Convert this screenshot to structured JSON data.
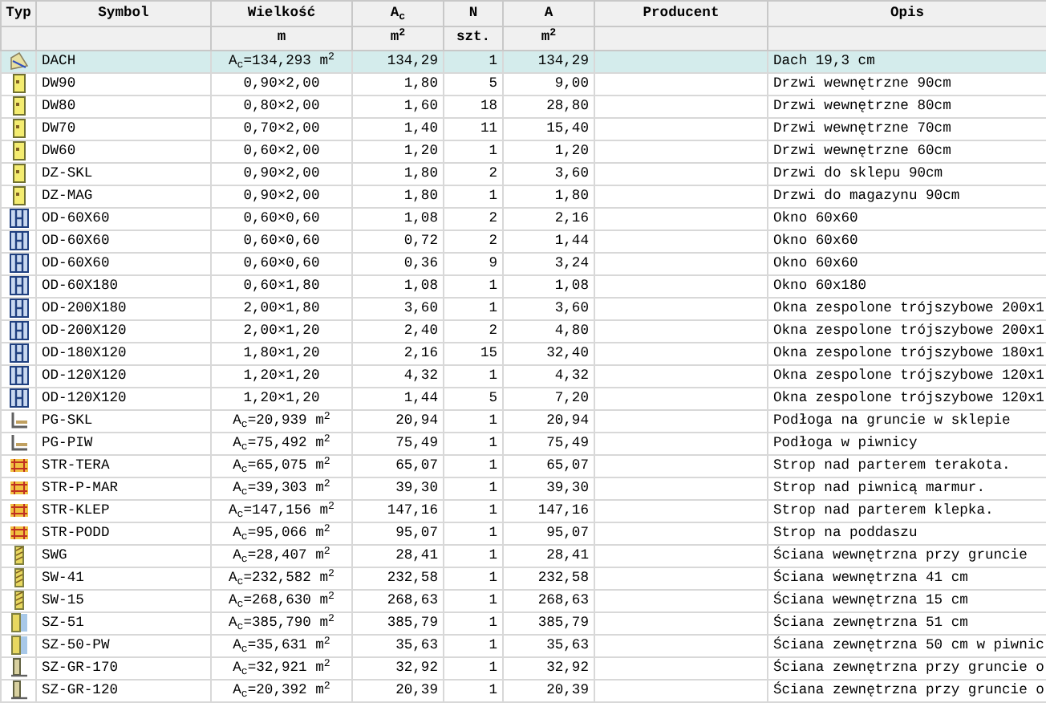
{
  "table": {
    "columns": [
      {
        "label": "Typ"
      },
      {
        "label": "Symbol"
      },
      {
        "label": "Wielkość",
        "unit": "m"
      },
      {
        "label": "A$_{c}$",
        "unit": "m$^{2}$"
      },
      {
        "label": "N",
        "unit": "szt."
      },
      {
        "label": "A",
        "unit": "m$^{2}$"
      },
      {
        "label": "Producent"
      },
      {
        "label": "Opis"
      }
    ],
    "rows": [
      {
        "kind": "roof",
        "selected": true,
        "symbol": "DACH",
        "size": "A$_{c}$=134,293 m$^{2}$",
        "ac": "134,29",
        "n": "1",
        "a": "134,29",
        "description": "Dach 19,3 cm"
      },
      {
        "kind": "door",
        "selected": false,
        "symbol": "DW90",
        "size": "0,90×2,00",
        "ac": "1,80",
        "n": "5",
        "a": "9,00",
        "description": "Drzwi wewnętrzne 90cm"
      },
      {
        "kind": "door",
        "selected": false,
        "symbol": "DW80",
        "size": "0,80×2,00",
        "ac": "1,60",
        "n": "18",
        "a": "28,80",
        "description": "Drzwi wewnętrzne 80cm"
      },
      {
        "kind": "door",
        "selected": false,
        "symbol": "DW70",
        "size": "0,70×2,00",
        "ac": "1,40",
        "n": "11",
        "a": "15,40",
        "description": "Drzwi wewnętrzne 70cm"
      },
      {
        "kind": "door",
        "selected": false,
        "symbol": "DW60",
        "size": "0,60×2,00",
        "ac": "1,20",
        "n": "1",
        "a": "1,20",
        "description": "Drzwi wewnętrzne 60cm"
      },
      {
        "kind": "door",
        "selected": false,
        "symbol": "DZ-SKL",
        "size": "0,90×2,00",
        "ac": "1,80",
        "n": "2",
        "a": "3,60",
        "description": "Drzwi do sklepu 90cm"
      },
      {
        "kind": "door",
        "selected": false,
        "symbol": "DZ-MAG",
        "size": "0,90×2,00",
        "ac": "1,80",
        "n": "1",
        "a": "1,80",
        "description": "Drzwi do magazynu 90cm"
      },
      {
        "kind": "window",
        "selected": false,
        "symbol": "OD-60X60",
        "size": "0,60×0,60",
        "ac": "1,08",
        "n": "2",
        "a": "2,16",
        "description": "Okno 60x60"
      },
      {
        "kind": "window",
        "selected": false,
        "symbol": "OD-60X60",
        "size": "0,60×0,60",
        "ac": "0,72",
        "n": "2",
        "a": "1,44",
        "description": "Okno 60x60"
      },
      {
        "kind": "window",
        "selected": false,
        "symbol": "OD-60X60",
        "size": "0,60×0,60",
        "ac": "0,36",
        "n": "9",
        "a": "3,24",
        "description": "Okno 60x60"
      },
      {
        "kind": "window",
        "selected": false,
        "symbol": "OD-60X180",
        "size": "0,60×1,80",
        "ac": "1,08",
        "n": "1",
        "a": "1,08",
        "description": "Okno 60x180"
      },
      {
        "kind": "window",
        "selected": false,
        "symbol": "OD-200X180",
        "size": "2,00×1,80",
        "ac": "3,60",
        "n": "1",
        "a": "3,60",
        "description": "Okna zespolone trójszybowe 200x1"
      },
      {
        "kind": "window",
        "selected": false,
        "symbol": "OD-200X120",
        "size": "2,00×1,20",
        "ac": "2,40",
        "n": "2",
        "a": "4,80",
        "description": "Okna zespolone trójszybowe 200x1"
      },
      {
        "kind": "window",
        "selected": false,
        "symbol": "OD-180X120",
        "size": "1,80×1,20",
        "ac": "2,16",
        "n": "15",
        "a": "32,40",
        "description": "Okna zespolone trójszybowe 180x1"
      },
      {
        "kind": "window",
        "selected": false,
        "symbol": "OD-120X120",
        "size": "1,20×1,20",
        "ac": "4,32",
        "n": "1",
        "a": "4,32",
        "description": "Okna zespolone trójszybowe 120x1"
      },
      {
        "kind": "window",
        "selected": false,
        "symbol": "OD-120X120",
        "size": "1,20×1,20",
        "ac": "1,44",
        "n": "5",
        "a": "7,20",
        "description": "Okna zespolone trójszybowe 120x1"
      },
      {
        "kind": "floor",
        "selected": false,
        "symbol": "PG-SKL",
        "size": "A$_{c}$=20,939 m$^{2}$",
        "ac": "20,94",
        "n": "1",
        "a": "20,94",
        "description": "Podłoga na gruncie w sklepie"
      },
      {
        "kind": "floor",
        "selected": false,
        "symbol": "PG-PIW",
        "size": "A$_{c}$=75,492 m$^{2}$",
        "ac": "75,49",
        "n": "1",
        "a": "75,49",
        "description": "Podłoga w piwnicy"
      },
      {
        "kind": "ceiling",
        "selected": false,
        "symbol": "STR-TERA",
        "size": "A$_{c}$=65,075 m$^{2}$",
        "ac": "65,07",
        "n": "1",
        "a": "65,07",
        "description": "Strop nad parterem terakota."
      },
      {
        "kind": "ceiling",
        "selected": false,
        "symbol": "STR-P-MAR",
        "size": "A$_{c}$=39,303 m$^{2}$",
        "ac": "39,30",
        "n": "1",
        "a": "39,30",
        "description": "Strop nad piwnicą marmur."
      },
      {
        "kind": "ceiling",
        "selected": false,
        "symbol": "STR-KLEP",
        "size": "A$_{c}$=147,156 m$^{2}$",
        "ac": "147,16",
        "n": "1",
        "a": "147,16",
        "description": "Strop nad parterem klepka."
      },
      {
        "kind": "ceiling",
        "selected": false,
        "symbol": "STR-PODD",
        "size": "A$_{c}$=95,066 m$^{2}$",
        "ac": "95,07",
        "n": "1",
        "a": "95,07",
        "description": "Strop na poddaszu"
      },
      {
        "kind": "wall",
        "selected": false,
        "symbol": "SWG",
        "size": "A$_{c}$=28,407 m$^{2}$",
        "ac": "28,41",
        "n": "1",
        "a": "28,41",
        "description": "Ściana wewnętrzna przy gruncie"
      },
      {
        "kind": "wall",
        "selected": false,
        "symbol": "SW-41",
        "size": "A$_{c}$=232,582 m$^{2}$",
        "ac": "232,58",
        "n": "1",
        "a": "232,58",
        "description": "Ściana wewnętrzna 41 cm"
      },
      {
        "kind": "wall",
        "selected": false,
        "symbol": "SW-15",
        "size": "A$_{c}$=268,630 m$^{2}$",
        "ac": "268,63",
        "n": "1",
        "a": "268,63",
        "description": "Ściana wewnętrzna 15 cm"
      },
      {
        "kind": "outer-wall",
        "selected": false,
        "symbol": "SZ-51",
        "size": "A$_{c}$=385,790 m$^{2}$",
        "ac": "385,79",
        "n": "1",
        "a": "385,79",
        "description": "Ściana zewnętrzna 51 cm"
      },
      {
        "kind": "outer-wall",
        "selected": false,
        "symbol": "SZ-50-PW",
        "size": "A$_{c}$=35,631 m$^{2}$",
        "ac": "35,63",
        "n": "1",
        "a": "35,63",
        "description": "Ściana zewnętrzna 50 cm w piwnic"
      },
      {
        "kind": "ground-wall",
        "selected": false,
        "symbol": "SZ-GR-170",
        "size": "A$_{c}$=32,921 m$^{2}$",
        "ac": "32,92",
        "n": "1",
        "a": "32,92",
        "description": "Ściana zewnętrzna przy gruncie o"
      },
      {
        "kind": "ground-wall",
        "selected": false,
        "symbol": "SZ-GR-120",
        "size": "A$_{c}$=20,392 m$^{2}$",
        "ac": "20,39",
        "n": "1",
        "a": "20,39",
        "description": "Ściana zewnętrzna przy gruncie o"
      }
    ]
  }
}
